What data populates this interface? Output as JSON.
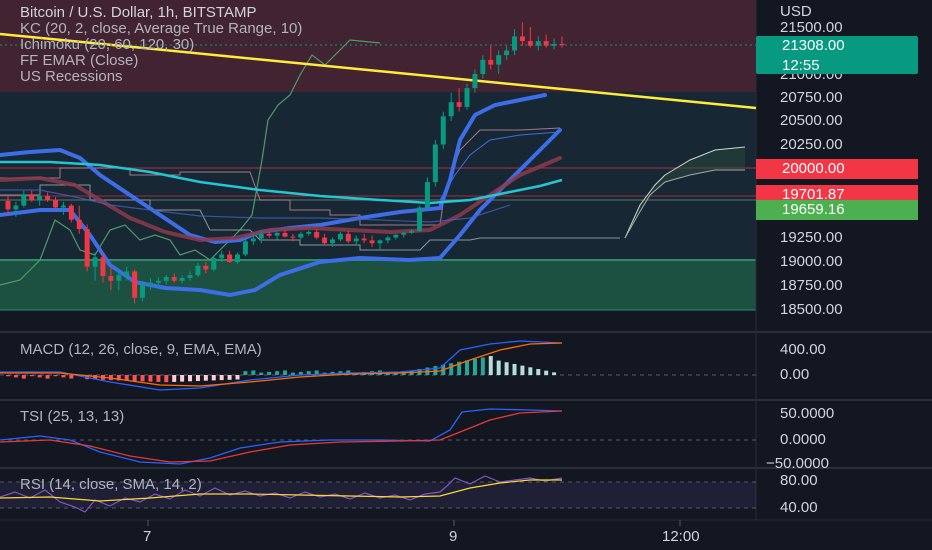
{
  "chart_data": {
    "type": "candlestick",
    "symbol_line": "Bitcoin / U.S. Dollar, 1h, BITSTAMP",
    "indicators": [
      "KC (20, 2, close, Average True Range, 10)",
      "Ichimoku (20, 60, 120, 30)",
      "FF EMAR (Close)",
      "US Recessions"
    ],
    "currency": "USD",
    "price_ticks": [
      "21500.00",
      "21000.00",
      "20750.00",
      "20500.00",
      "20250.00",
      "19250.00",
      "19000.00",
      "18750.00",
      "18500.00"
    ],
    "price_tags": [
      {
        "text": "21308.00",
        "sub": "12:55",
        "color": "#089981"
      },
      {
        "text": "20000.00",
        "sub": "",
        "color": "#f23645"
      },
      {
        "text": "19701.87",
        "sub": "",
        "color": "#f23645"
      },
      {
        "text": "19659.16",
        "sub": "",
        "color": "#4caf50"
      }
    ],
    "time_labels": [
      "7",
      "9",
      "12:00"
    ],
    "candles_ohlc": [
      [
        19650,
        19700,
        19500,
        19560
      ],
      [
        19560,
        19640,
        19480,
        19600
      ],
      [
        19600,
        19760,
        19580,
        19720
      ],
      [
        19720,
        19760,
        19640,
        19660
      ],
      [
        19660,
        19720,
        19600,
        19700
      ],
      [
        19700,
        19740,
        19640,
        19660
      ],
      [
        19660,
        19690,
        19560,
        19580
      ],
      [
        19580,
        19640,
        19500,
        19600
      ],
      [
        19600,
        19620,
        19420,
        19450
      ],
      [
        19450,
        19600,
        19300,
        19350
      ],
      [
        19350,
        19400,
        18900,
        18950
      ],
      [
        18950,
        19100,
        18800,
        19050
      ],
      [
        19050,
        19100,
        18780,
        18850
      ],
      [
        18850,
        18950,
        18700,
        18800
      ],
      [
        18800,
        18900,
        18700,
        18860
      ],
      [
        18860,
        18950,
        18800,
        18900
      ],
      [
        18900,
        18920,
        18560,
        18620
      ],
      [
        18620,
        18800,
        18580,
        18760
      ],
      [
        18760,
        18830,
        18700,
        18780
      ],
      [
        18780,
        18840,
        18720,
        18800
      ],
      [
        18800,
        18860,
        18760,
        18840
      ],
      [
        18840,
        18880,
        18780,
        18800
      ],
      [
        18800,
        18860,
        18770,
        18830
      ],
      [
        18830,
        18900,
        18800,
        18860
      ],
      [
        18860,
        18990,
        18840,
        18960
      ],
      [
        18960,
        19000,
        18880,
        18920
      ],
      [
        18920,
        19060,
        18900,
        19040
      ],
      [
        19040,
        19120,
        19000,
        19080
      ],
      [
        19080,
        19120,
        18990,
        19000
      ],
      [
        19000,
        19100,
        18980,
        19080
      ],
      [
        19080,
        19260,
        19060,
        19220
      ],
      [
        19220,
        19300,
        19180,
        19250
      ],
      [
        19250,
        19330,
        19200,
        19300
      ],
      [
        19300,
        19320,
        19260,
        19280
      ],
      [
        19280,
        19320,
        19240,
        19310
      ],
      [
        19310,
        19340,
        19260,
        19270
      ],
      [
        19270,
        19300,
        19220,
        19260
      ],
      [
        19260,
        19320,
        19240,
        19300
      ],
      [
        19300,
        19340,
        19280,
        19320
      ],
      [
        19320,
        19350,
        19240,
        19260
      ],
      [
        19260,
        19300,
        19180,
        19200
      ],
      [
        19200,
        19260,
        19160,
        19240
      ],
      [
        19240,
        19320,
        19220,
        19300
      ],
      [
        19300,
        19330,
        19200,
        19220
      ],
      [
        19220,
        19280,
        19180,
        19250
      ],
      [
        19250,
        19300,
        19200,
        19230
      ],
      [
        19230,
        19280,
        19160,
        19200
      ],
      [
        19200,
        19240,
        19120,
        19230
      ],
      [
        19230,
        19280,
        19200,
        19260
      ],
      [
        19260,
        19300,
        19240,
        19290
      ],
      [
        19290,
        19320,
        19260,
        19310
      ],
      [
        19310,
        19350,
        19300,
        19330
      ],
      [
        19330,
        19600,
        19320,
        19580
      ],
      [
        19580,
        19900,
        19560,
        19850
      ],
      [
        19850,
        20300,
        19800,
        20250
      ],
      [
        20250,
        20600,
        20200,
        20550
      ],
      [
        20550,
        20800,
        20500,
        20700
      ],
      [
        20700,
        20850,
        20600,
        20650
      ],
      [
        20650,
        20900,
        20620,
        20850
      ],
      [
        20850,
        21050,
        20800,
        21000
      ],
      [
        21000,
        21200,
        20950,
        21150
      ],
      [
        21150,
        21300,
        21050,
        21100
      ],
      [
        21100,
        21250,
        21000,
        21200
      ],
      [
        21200,
        21300,
        21150,
        21250
      ],
      [
        21250,
        21480,
        21200,
        21400
      ],
      [
        21400,
        21550,
        21300,
        21350
      ],
      [
        21350,
        21500,
        21280,
        21300
      ],
      [
        21300,
        21400,
        21250,
        21350
      ],
      [
        21350,
        21420,
        21280,
        21300
      ],
      [
        21300,
        21380,
        21260,
        21320
      ],
      [
        21320,
        21400,
        21280,
        21308
      ]
    ],
    "trendline": {
      "from": [
        0,
        21400
      ],
      "to": [
        70,
        20720
      ],
      "color": "#ffeb3b"
    },
    "horizontal_levels": [
      20000,
      19701.87,
      19659.16
    ],
    "panes": [
      {
        "name": "MACD (12, 26, close, 9, EMA, EMA)",
        "ticks": [
          "400.00",
          "0.00"
        ]
      },
      {
        "name": "TSI (25, 13, 13)",
        "ticks": [
          "50.0000",
          "0.0000",
          "−50.0000"
        ]
      },
      {
        "name": "RSI (14, close, SMA, 14, 2)",
        "ticks": [
          "80.00",
          "40.00"
        ]
      }
    ]
  }
}
